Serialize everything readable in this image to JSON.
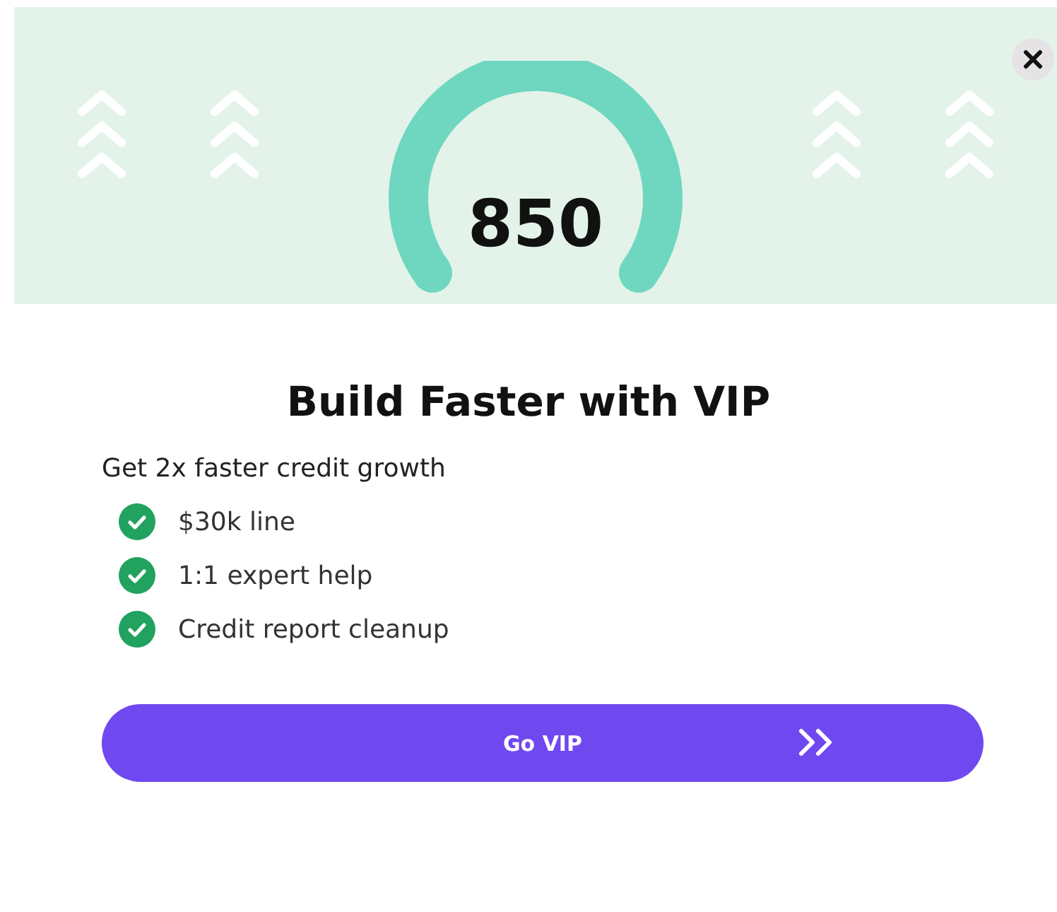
{
  "score": "850",
  "title": "Build Faster with VIP",
  "subtitle": "Get 2x faster credit growth",
  "features": [
    "$30k line",
    "1:1 expert help",
    "Credit report cleanup"
  ],
  "button": {
    "label": "Go VIP"
  }
}
